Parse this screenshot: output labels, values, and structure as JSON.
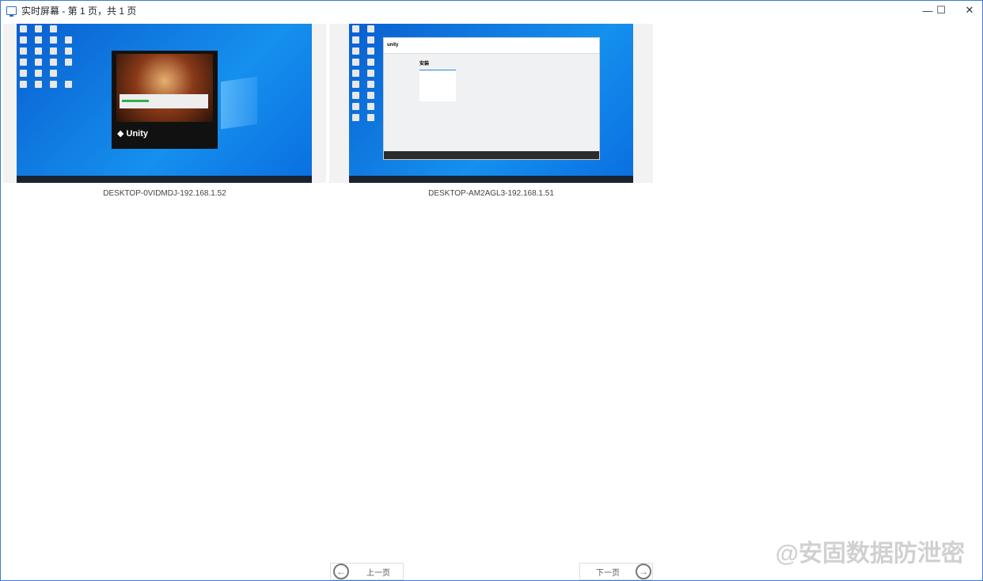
{
  "window": {
    "title": "实时屏幕 - 第 1 页，共 1 页",
    "minimize": "—",
    "maximize": "☐",
    "close": "✕"
  },
  "screens": [
    {
      "label": "DESKTOP-0VIDMDJ-192.168.1.52",
      "splash_brand": "Unity"
    },
    {
      "label": "DESKTOP-AM2AGL3-192.168.1.51",
      "app_brand": "unity",
      "app_heading": "安装"
    }
  ],
  "pager": {
    "prev_label": "上一页",
    "next_label": "下一页"
  },
  "watermark": "@安固数据防泄密"
}
